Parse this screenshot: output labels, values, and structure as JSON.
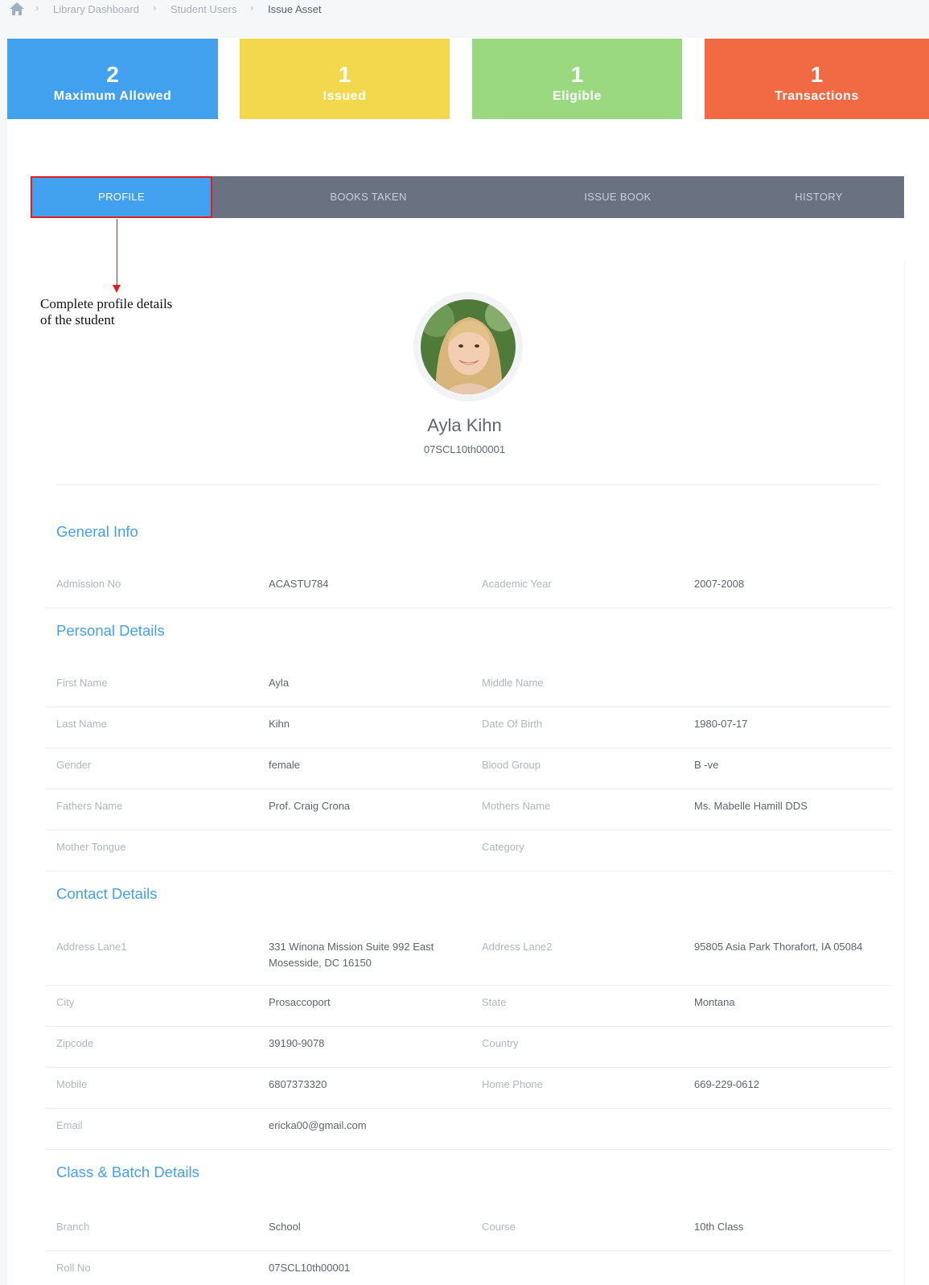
{
  "breadcrumb": {
    "items": [
      "Library Dashboard",
      "Student Users",
      "Issue Asset"
    ]
  },
  "stats": [
    {
      "value": "2",
      "label": "Maximum Allowed",
      "color": "#42a1ef"
    },
    {
      "value": "1",
      "label": "Issued",
      "color": "#f3d84d"
    },
    {
      "value": "1",
      "label": "Eligible",
      "color": "#9ad97f"
    },
    {
      "value": "1",
      "label": "Transactions",
      "color": "#f16a43"
    }
  ],
  "tabs": [
    {
      "label": "PROFILE",
      "active": true
    },
    {
      "label": "BOOKS TAKEN",
      "active": false
    },
    {
      "label": "ISSUE BOOK",
      "active": false
    },
    {
      "label": "HISTORY",
      "active": false
    }
  ],
  "annotation": {
    "line1": "Complete profile details",
    "line2": "of the student"
  },
  "profile": {
    "name": "Ayla Kihn",
    "student_id": "07SCL10th00001"
  },
  "sections": {
    "general": {
      "title": "General Info",
      "rows": [
        {
          "k1": "Admission No",
          "v1": "ACASTU784",
          "k2": "Academic Year",
          "v2": "2007-2008"
        }
      ]
    },
    "personal": {
      "title": "Personal Details",
      "rows": [
        {
          "k1": "First Name",
          "v1": "Ayla",
          "k2": "Middle Name",
          "v2": ""
        },
        {
          "k1": "Last Name",
          "v1": "Kihn",
          "k2": "Date Of Birth",
          "v2": "1980-07-17"
        },
        {
          "k1": "Gender",
          "v1": "female",
          "k2": "Blood Group",
          "v2": "B -ve"
        },
        {
          "k1": "Fathers Name",
          "v1": "Prof. Craig Crona",
          "k2": "Mothers Name",
          "v2": "Ms. Mabelle Hamill DDS"
        },
        {
          "k1": "Mother Tongue",
          "v1": "",
          "k2": "Category",
          "v2": ""
        }
      ]
    },
    "contact": {
      "title": "Contact  Details",
      "rows": [
        {
          "k1": "Address Lane1",
          "v1": "331 Winona Mission Suite 992 East Mosesside, DC 16150",
          "k2": "Address Lane2",
          "v2": "95805 Asia Park Thorafort, IA 05084"
        },
        {
          "k1": "City",
          "v1": "Prosaccoport",
          "k2": "State",
          "v2": "Montana"
        },
        {
          "k1": "Zipcode",
          "v1": "39190-9078",
          "k2": "Country",
          "v2": ""
        },
        {
          "k1": "Mobile",
          "v1": "6807373320",
          "k2": "Home Phone",
          "v2": "669-229-0612"
        },
        {
          "k1": "Email",
          "v1": "ericka00@gmail.com",
          "k2": "",
          "v2": ""
        }
      ]
    },
    "class": {
      "title": "Class & Batch Details",
      "rows": [
        {
          "k1": "Branch",
          "v1": "School",
          "k2": "Course",
          "v2": "10th Class"
        },
        {
          "k1": "Roll No",
          "v1": "07SCL10th00001",
          "k2": "",
          "v2": ""
        }
      ]
    }
  }
}
